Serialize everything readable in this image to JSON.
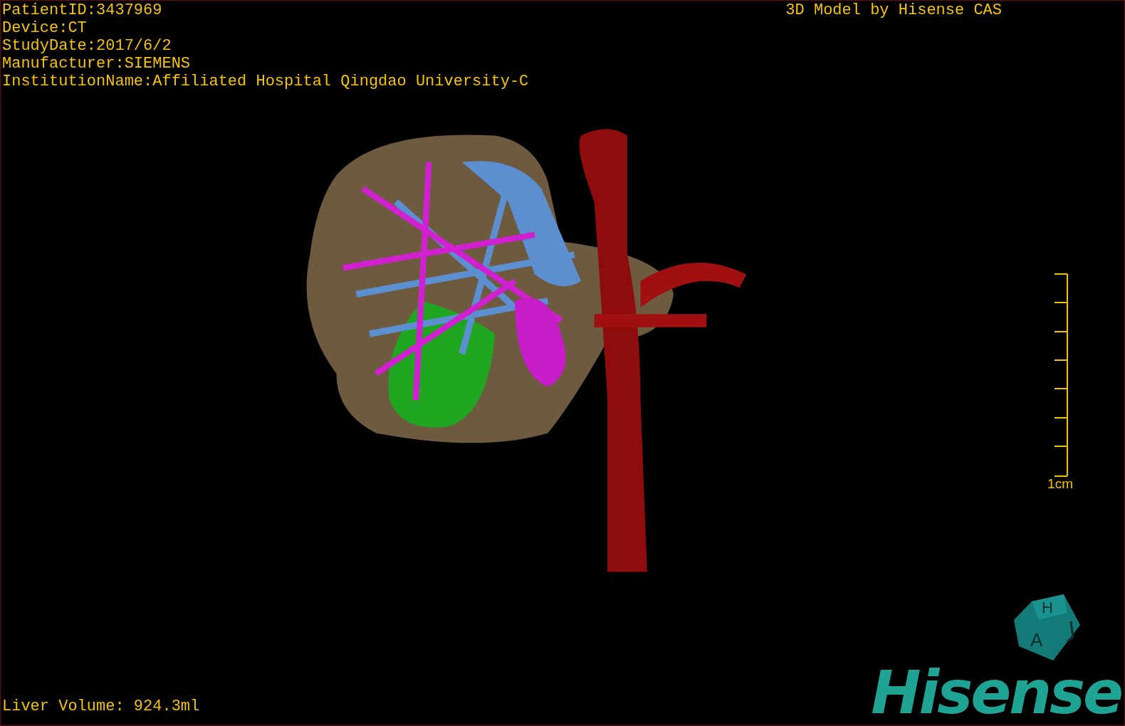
{
  "patient_info": [
    "PatientID:3437969",
    "Device:CT",
    "StudyDate:2017/6/2",
    "Manufacturer:SIEMENS",
    "InstitutionName:Affiliated Hospital Qingdao University-C"
  ],
  "title": "3D Model by Hisense CAS",
  "scale_bar": {
    "label": "1cm"
  },
  "liver_volume": "Liver Volume: 924.3ml",
  "orientation_cube": {
    "labels": [
      "H",
      "A"
    ]
  },
  "logo": "Hisense"
}
